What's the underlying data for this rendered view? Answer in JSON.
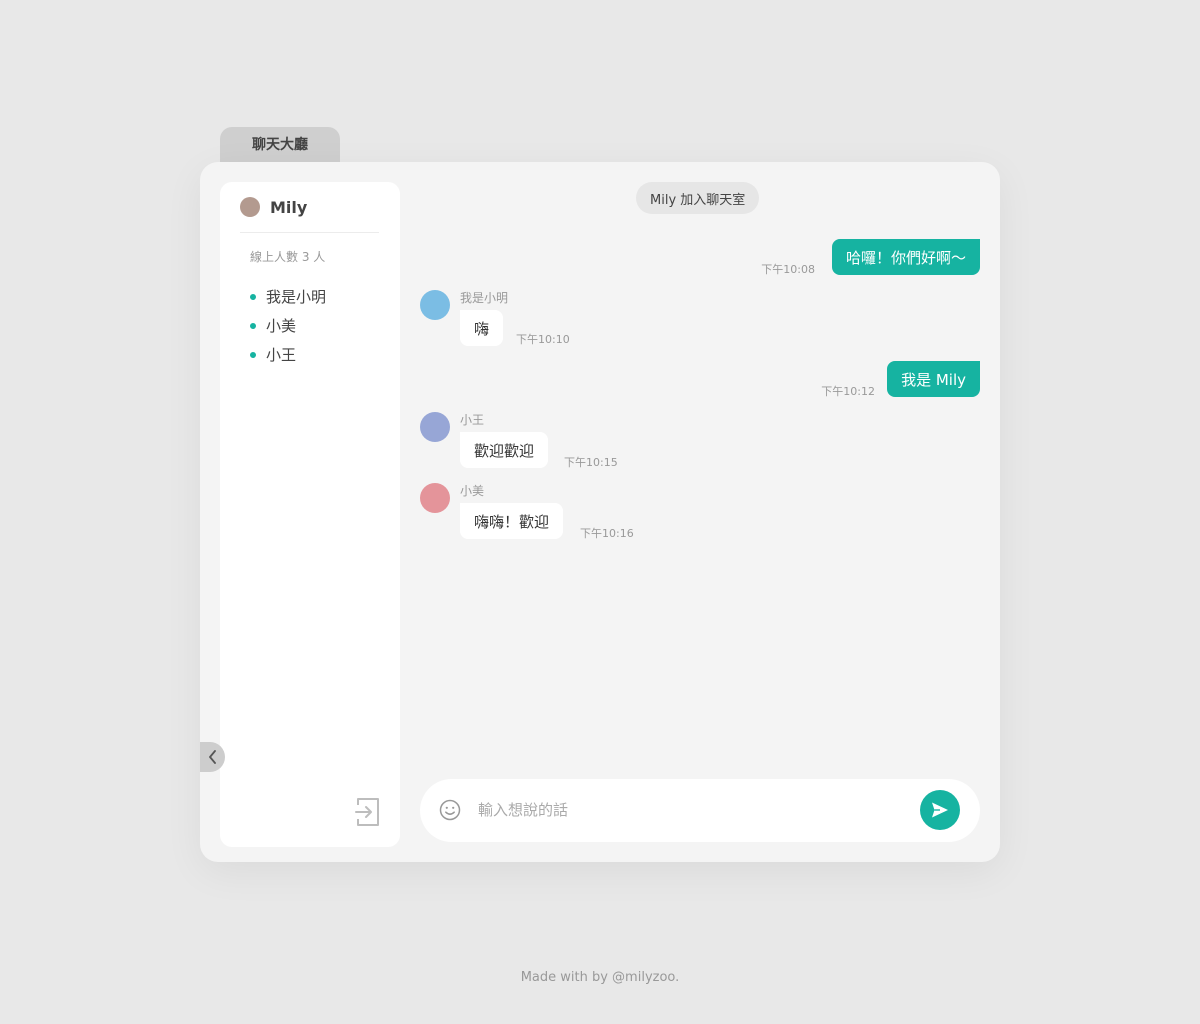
{
  "tab": {
    "label": "聊天大廳"
  },
  "sidebar": {
    "current_user": "Mily",
    "online_count": "線上人數 3 人",
    "users": [
      {
        "name": "我是小明"
      },
      {
        "name": "小美"
      },
      {
        "name": "小王"
      }
    ]
  },
  "chat": {
    "system_message": "Mily 加入聊天室",
    "messages": [
      {
        "direction": "out",
        "text": "哈囉！你們好啊〜",
        "time": "下午10:08"
      },
      {
        "direction": "in",
        "sender": "我是小明",
        "text": "嗨",
        "time": "下午10:10",
        "avatar_color": "#7bbde4"
      },
      {
        "direction": "out",
        "text": "我是 Mily",
        "time": "下午10:12"
      },
      {
        "direction": "in",
        "sender": "小王",
        "text": "歡迎歡迎",
        "time": "下午10:15",
        "avatar_color": "#97a6d6"
      },
      {
        "direction": "in",
        "sender": "小美",
        "text": "嗨嗨！歡迎",
        "time": "下午10:16",
        "avatar_color": "#e4949a"
      }
    ]
  },
  "composer": {
    "placeholder": "輸入想說的話",
    "value": ""
  },
  "footer": {
    "text": "Made with by @milyzoo."
  },
  "colors": {
    "accent": "#16b3a1",
    "background": "#e8e8e8",
    "panel": "#f4f4f4",
    "my_avatar": "#b39a8f"
  },
  "icons": {
    "emoji": "smile-icon",
    "send": "send-icon",
    "logout": "logout-icon",
    "collapse": "chevron-left-icon"
  }
}
